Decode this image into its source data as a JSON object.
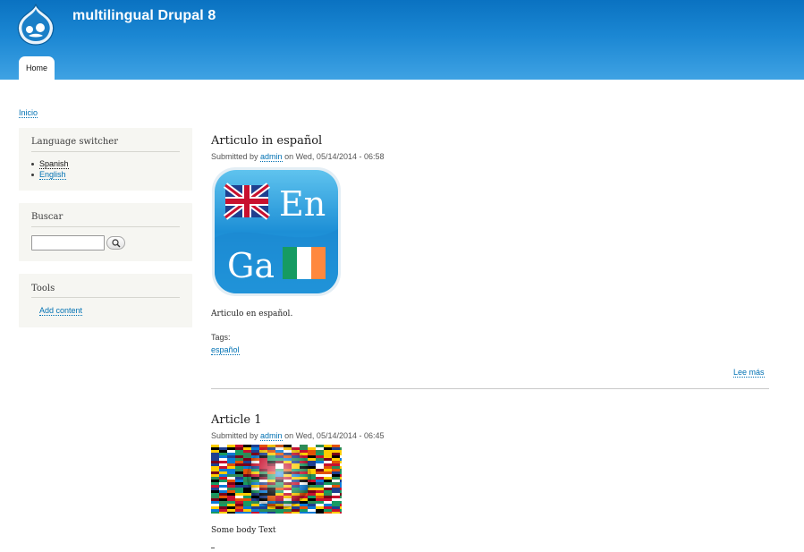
{
  "site": {
    "name": "multilingual Drupal 8"
  },
  "nav": {
    "tabs": [
      {
        "label": "Home",
        "active": true
      }
    ]
  },
  "breadcrumb": {
    "home": "Inicio"
  },
  "sidebar": {
    "language_switcher": {
      "title": "Language switcher",
      "items": [
        {
          "label": "Spanish",
          "active": true
        },
        {
          "label": "English",
          "active": false
        }
      ]
    },
    "search": {
      "title": "Buscar",
      "input_value": "",
      "button_icon": "search-icon"
    },
    "tools": {
      "title": "Tools",
      "links": [
        {
          "label": "Add content"
        }
      ]
    }
  },
  "articles": [
    {
      "title": "Articulo in español",
      "submitted_prefix": "Submitted by",
      "author": "admin",
      "submitted_suffix": "on Wed, 05/14/2014 - 06:58",
      "image_icon": "en-ga-flags-icon",
      "image_text": {
        "top": "En",
        "bottom": "Ga"
      },
      "body": "Articulo en español.",
      "tags_label": "Tags:",
      "tags": [
        "español"
      ],
      "read_more": "Lee más"
    },
    {
      "title": "Article 1",
      "submitted_prefix": "Submitted by",
      "author": "admin",
      "submitted_suffix": "on Wed, 05/14/2014 - 06:45",
      "image_icon": "world-flags-globe-image",
      "body": "Some body Text"
    }
  ],
  "colors": {
    "header_top": "#0a72c1",
    "header_bottom": "#3fa2e3",
    "link": "#0071b3",
    "sidebar_bg": "#f6f6f2"
  }
}
